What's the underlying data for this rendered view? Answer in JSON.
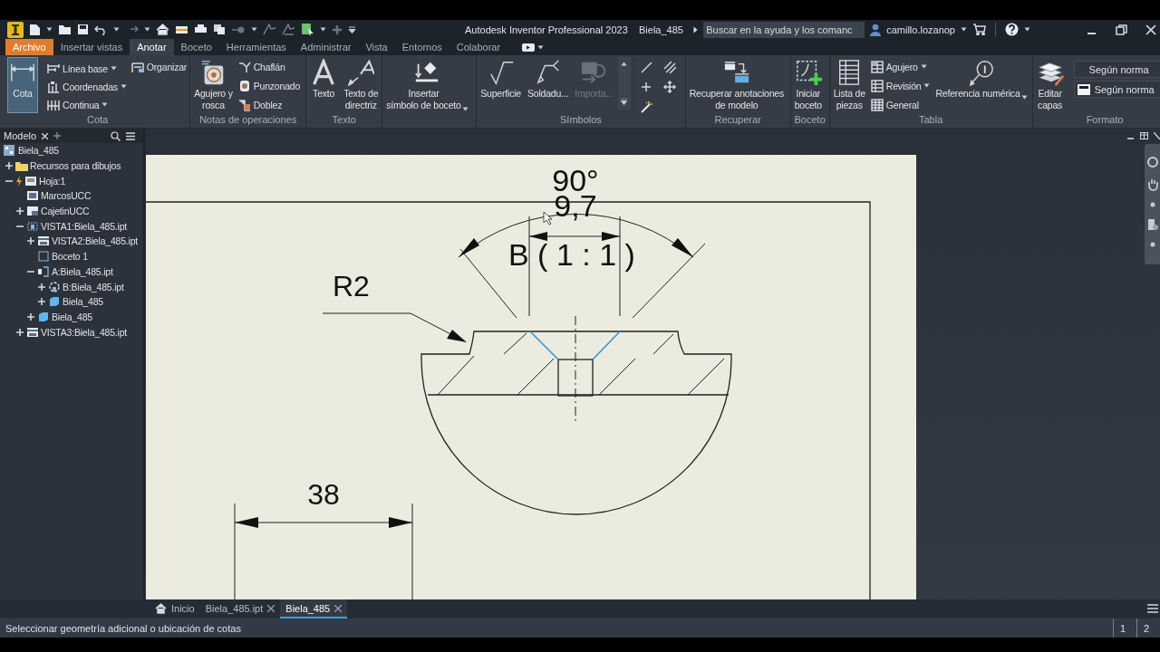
{
  "title_bar": {
    "app_title": "Autodesk Inventor Professional 2023",
    "document": "Biela_485",
    "search": {
      "placeholder": "Buscar en la ayuda y los comanc"
    },
    "user": "camillo.lozanop"
  },
  "ribbon_tabs": [
    {
      "label": "Archivo",
      "kind": "file",
      "selected": false
    },
    {
      "label": "Insertar vistas",
      "kind": "tab",
      "selected": false
    },
    {
      "label": "Anotar",
      "kind": "tab",
      "selected": true
    },
    {
      "label": "Boceto",
      "kind": "tab",
      "selected": false
    },
    {
      "label": "Herramientas",
      "kind": "tab",
      "selected": false
    },
    {
      "label": "Administrar",
      "kind": "tab",
      "selected": false
    },
    {
      "label": "Vista",
      "kind": "tab",
      "selected": false
    },
    {
      "label": "Entornos",
      "kind": "tab",
      "selected": false
    },
    {
      "label": "Colaborar",
      "kind": "tab",
      "selected": false
    }
  ],
  "ribbon_panels": [
    {
      "title": "Cota",
      "tools": [
        {
          "label": "Cota",
          "kind": "large",
          "pressed": true,
          "disabled": false,
          "dropdown": false
        },
        {
          "label": "Línea base",
          "kind": "small",
          "pressed": false,
          "disabled": false,
          "dropdown": true
        },
        {
          "label": "Coordenadas",
          "kind": "small",
          "pressed": false,
          "disabled": false,
          "dropdown": true
        },
        {
          "label": "Continua",
          "kind": "small",
          "pressed": false,
          "disabled": false,
          "dropdown": true
        },
        {
          "label": "Organizar",
          "kind": "small",
          "pressed": false,
          "disabled": false,
          "dropdown": false
        }
      ]
    },
    {
      "title": "Notas de operaciones",
      "tools": [
        {
          "label": "Agujero y\nrosca",
          "kind": "large",
          "pressed": false,
          "disabled": false,
          "dropdown": false
        },
        {
          "label": "Chaflán",
          "kind": "small",
          "pressed": false,
          "disabled": false,
          "dropdown": false
        },
        {
          "label": "Punzonado",
          "kind": "small",
          "pressed": false,
          "disabled": false,
          "dropdown": false
        },
        {
          "label": "Doblez",
          "kind": "small",
          "pressed": false,
          "disabled": false,
          "dropdown": false
        }
      ]
    },
    {
      "title": "Texto",
      "tools": [
        {
          "label": "Texto",
          "kind": "large",
          "pressed": false,
          "disabled": false,
          "dropdown": false
        },
        {
          "label": "Texto de\ndirectriz",
          "kind": "large",
          "pressed": false,
          "disabled": false,
          "dropdown": false
        }
      ]
    },
    {
      "tools": [
        {
          "label": "Insertar\nsímbolo de boceto",
          "kind": "large",
          "pressed": false,
          "disabled": false,
          "dropdown": true
        }
      ]
    },
    {
      "title": "Símbolos",
      "tools": [
        {
          "label": "Superficie",
          "kind": "large",
          "pressed": false,
          "disabled": false,
          "dropdown": false
        },
        {
          "label": "Soldadu...",
          "kind": "large",
          "pressed": false,
          "disabled": false,
          "dropdown": false
        },
        {
          "label": "Importa...",
          "kind": "large",
          "pressed": false,
          "disabled": true,
          "dropdown": false
        },
        {
          "kind": "scroller",
          "pressed": false,
          "disabled": false,
          "dropdown": false
        },
        {
          "kind": "icon",
          "pressed": false,
          "disabled": false,
          "dropdown": false
        },
        {
          "kind": "icon",
          "pressed": false,
          "disabled": false,
          "dropdown": false
        },
        {
          "kind": "icon",
          "pressed": false,
          "disabled": false,
          "dropdown": false
        },
        {
          "kind": "icon",
          "pressed": false,
          "disabled": false,
          "dropdown": false
        },
        {
          "kind": "icon",
          "pressed": false,
          "disabled": false,
          "dropdown": false
        }
      ]
    },
    {
      "title": "Recuperar",
      "tools": [
        {
          "label": "Recuperar anotaciones\nde modelo",
          "kind": "large",
          "pressed": false,
          "disabled": false,
          "dropdown": false
        }
      ]
    },
    {
      "title": "Boceto",
      "tools": [
        {
          "label": "Iniciar\nboceto",
          "kind": "large",
          "pressed": false,
          "disabled": false,
          "dropdown": false
        }
      ]
    },
    {
      "title": "Tabla",
      "tools": [
        {
          "label": "Lista de\npiezas",
          "kind": "large",
          "pressed": false,
          "disabled": false,
          "dropdown": false
        },
        {
          "label": "Agujero",
          "kind": "small",
          "pressed": false,
          "disabled": false,
          "dropdown": true
        },
        {
          "label": "Revisión",
          "kind": "small",
          "pressed": false,
          "disabled": false,
          "dropdown": true
        },
        {
          "label": "General",
          "kind": "small",
          "pressed": false,
          "disabled": false,
          "dropdown": false
        },
        {
          "label": "Referencia numérica",
          "kind": "large",
          "pressed": false,
          "disabled": false,
          "dropdown": true
        }
      ]
    },
    {
      "title": "Formato",
      "tools": [
        {
          "label": "Editar\ncapas",
          "kind": "large",
          "pressed": false,
          "disabled": false,
          "dropdown": false
        },
        {
          "label": "Según norma",
          "kind": "select",
          "pressed": false,
          "disabled": false,
          "dropdown": true
        },
        {
          "label": "Según norma",
          "kind": "select",
          "pressed": false,
          "disabled": false,
          "dropdown": true
        }
      ]
    }
  ],
  "browser": {
    "tab": "Modelo",
    "tree": [
      {
        "label": "Biela_485",
        "kind": "document",
        "children": [
          {
            "label": "Recursos para dibujos",
            "kind": "folder",
            "expandable": true,
            "expanded": false
          },
          {
            "label": "Hoja:1",
            "kind": "sheet",
            "expandable": true,
            "expanded": true,
            "children": [
              {
                "label": "MarcosUCC",
                "kind": "border",
                "expandable": false,
                "expanded": false
              },
              {
                "label": "CajetinUCC",
                "kind": "titleblock",
                "expandable": true,
                "expanded": false
              },
              {
                "label": "VISTA1:Biela_485.ipt",
                "kind": "base_view",
                "expandable": true,
                "expanded": true,
                "children": [
                  {
                    "label": "VISTA2:Biela_485.ipt",
                    "kind": "view",
                    "expandable": true,
                    "expanded": false
                  },
                  {
                    "label": "Boceto 1",
                    "kind": "sketch",
                    "expandable": false,
                    "expanded": false
                  },
                  {
                    "label": "A:Biela_485.ipt",
                    "kind": "section",
                    "expandable": true,
                    "expanded": true,
                    "children": [
                      {
                        "label": "B:Biela_485.ipt",
                        "kind": "detail",
                        "expandable": true,
                        "expanded": false
                      },
                      {
                        "label": "Biela_485",
                        "kind": "body",
                        "expandable": true,
                        "expanded": false
                      }
                    ]
                  },
                  {
                    "label": "Biela_485",
                    "kind": "body",
                    "expandable": true,
                    "expanded": false
                  }
                ]
              },
              {
                "label": "VISTA3:Biela_485.ipt",
                "kind": "view",
                "expandable": true,
                "expanded": false
              }
            ]
          }
        ]
      }
    ]
  },
  "drawing": {
    "annotations": [
      "90°",
      "9,7",
      "B ( 1 : 1 )",
      "R2",
      "38"
    ]
  },
  "document_tabs": [
    {
      "label": "Inicio",
      "kind": "home",
      "selected": false
    },
    {
      "label": "Biela_485.ipt",
      "kind": "document",
      "selected": false
    },
    {
      "label": "Biela_485",
      "kind": "document",
      "selected": true
    }
  ],
  "status_bar": {
    "message": "Seleccionar geometría adicional o ubicación de cotas",
    "pages": [
      "1",
      "2"
    ]
  }
}
